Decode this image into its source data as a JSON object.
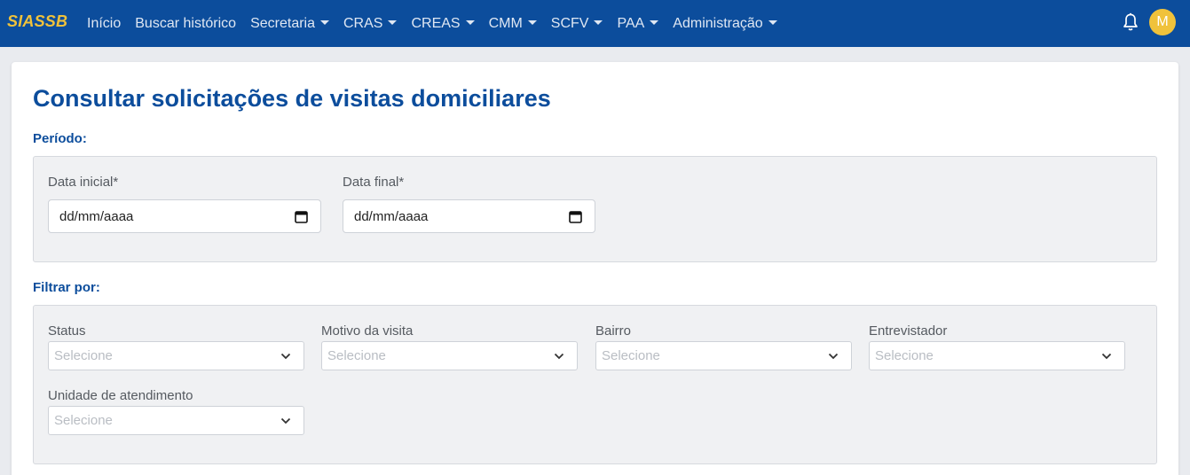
{
  "navbar": {
    "brand": "SIASSB",
    "items": [
      {
        "label": "Início",
        "dropdown": false
      },
      {
        "label": "Buscar histórico",
        "dropdown": false
      },
      {
        "label": "Secretaria",
        "dropdown": true
      },
      {
        "label": "CRAS",
        "dropdown": true
      },
      {
        "label": "CREAS",
        "dropdown": true
      },
      {
        "label": "CMM",
        "dropdown": true
      },
      {
        "label": "SCFV",
        "dropdown": true
      },
      {
        "label": "PAA",
        "dropdown": true
      },
      {
        "label": "Administração",
        "dropdown": true
      }
    ],
    "notification_icon": "bell-icon",
    "avatar_initial": "M"
  },
  "page": {
    "title": "Consultar solicitações de visitas domiciliares"
  },
  "period": {
    "label": "Período:",
    "start_label": "Data inicial*",
    "start_value": "dd/mm/aaaa",
    "end_label": "Data final*",
    "end_value": "dd/mm/aaaa"
  },
  "filters": {
    "label": "Filtrar por:",
    "status": {
      "label": "Status",
      "placeholder": "Selecione"
    },
    "reason": {
      "label": "Motivo da visita",
      "placeholder": "Selecione"
    },
    "neighborhood": {
      "label": "Bairro",
      "placeholder": "Selecione"
    },
    "interviewer": {
      "label": "Entrevistador",
      "placeholder": "Selecione"
    },
    "unit": {
      "label": "Unidade de atendimento",
      "placeholder": "Selecione"
    }
  },
  "colors": {
    "navbar": "#0c4d9c",
    "brand": "#f0c23b",
    "title": "#0c4d9c",
    "panel": "#f0f1f3"
  }
}
